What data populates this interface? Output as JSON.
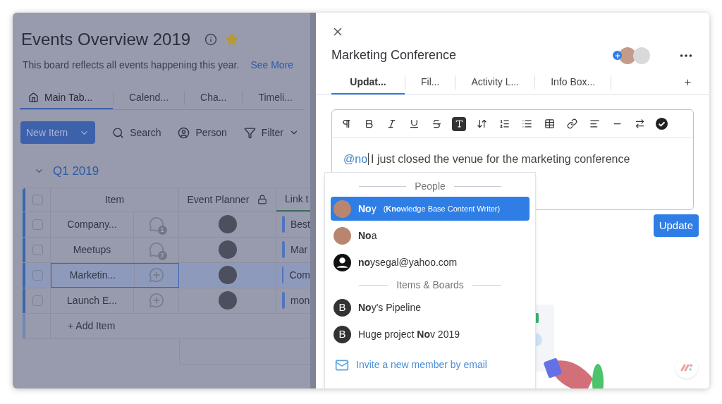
{
  "board": {
    "title": "Events Overview 2019",
    "starred": true,
    "description": "This board reflects all events happening this year.",
    "see_more": "See More",
    "tabs": [
      {
        "label": "Main Tab...",
        "selected": true,
        "home": true
      },
      {
        "label": "Calend...",
        "selected": false,
        "home": false
      },
      {
        "label": "Cha...",
        "selected": false,
        "home": false
      },
      {
        "label": "Timeli...",
        "selected": false,
        "home": false
      }
    ],
    "toolbar": {
      "new_item": "New Item",
      "search": "Search",
      "person": "Person",
      "filter": "Filter"
    },
    "group": {
      "title": "Q1 2019",
      "expanded": true
    },
    "columns": [
      "Item",
      "Event Planner",
      "Link t"
    ],
    "all_checked": false,
    "rows": [
      {
        "name": "Company...",
        "comments": "1",
        "selected": false,
        "checked": false,
        "link": "Best"
      },
      {
        "name": "Meetups",
        "comments": "2",
        "selected": false,
        "checked": false,
        "link": "Mar"
      },
      {
        "name": "Marketin...",
        "comments": null,
        "selected": true,
        "checked": false,
        "link": "Com"
      },
      {
        "name": "Launch E...",
        "comments": null,
        "selected": false,
        "checked": false,
        "link": "mon"
      }
    ],
    "add_item": "+ Add Item"
  },
  "panel": {
    "title": "Marketing Conference",
    "tabs": [
      {
        "label": "Updat...",
        "selected": true
      },
      {
        "label": "Fil...",
        "selected": false
      },
      {
        "label": "Activity L...",
        "selected": false
      },
      {
        "label": "Info Box...",
        "selected": false
      }
    ],
    "add_tab": "+",
    "editor": {
      "mention": "@no",
      "text": "I just closed the venue for the marketing conference"
    },
    "update_button": "Update",
    "suggestions": [
      {
        "heading": "People",
        "items": [
          {
            "kind": "photo",
            "label": "**No**y",
            "detail": "(**Kno**wledge Base Content Writer)",
            "selected": true
          },
          {
            "kind": "photo",
            "label": "**No**a",
            "selected": false
          },
          {
            "kind": "user",
            "label": "**no**ysegal@yahoo.com",
            "selected": false
          }
        ]
      },
      {
        "heading": "Items & Boards",
        "items": [
          {
            "kind": "board",
            "label": "**No**y's Pipeline",
            "badge": "B",
            "selected": false
          },
          {
            "kind": "board",
            "label": "Huge project **No**v 2019",
            "badge": "B",
            "selected": false
          }
        ]
      }
    ],
    "invite": "Invite a new member by email"
  }
}
